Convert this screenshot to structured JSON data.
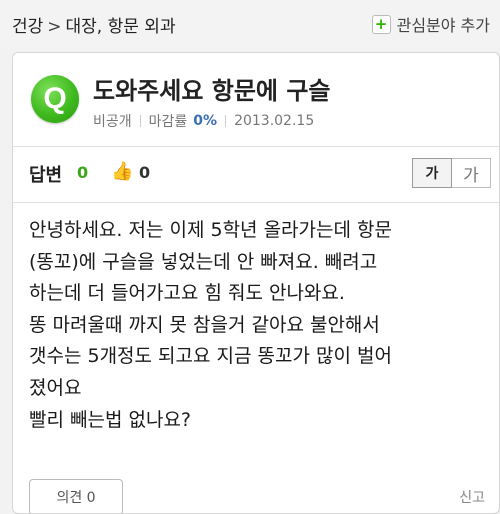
{
  "breadcrumb": {
    "parent": "건강",
    "separator": ">",
    "current": "대장, 항문 외과"
  },
  "favorite": {
    "icon": "plus-icon",
    "label": "관심분야 추가"
  },
  "question": {
    "icon_letter": "Q",
    "title": "도와주세요 항문에 구슬",
    "visibility": "비공개",
    "closing_label": "마감률",
    "closing_rate": "0%",
    "date": "2013.02.15"
  },
  "answers": {
    "label": "답변",
    "count": "0",
    "like_icon": "thumbs-up-icon",
    "like_count": "0"
  },
  "font_size": {
    "small": "가",
    "large": "가"
  },
  "body_lines": [
    "안녕하세요. 저는 이제 5학년 올라가는데 항문",
    "(똥꼬)에 구슬을 넣었는데 안 빠져요. 빼려고",
    "하는데 더 들어가고요 힘 줘도 안나와요.",
    "똥 마려울때 까지 못 참을거 같아요 불안해서",
    "갯수는 5개정도 되고요 지금 똥꼬가 많이 벌어",
    "졌어요",
    "빨리 빼는법 없나요?"
  ],
  "actions": {
    "opinion": "의견 0",
    "report": "신고"
  },
  "colors": {
    "accent_green": "#3ca51c",
    "rate_blue": "#3b6fb6"
  }
}
